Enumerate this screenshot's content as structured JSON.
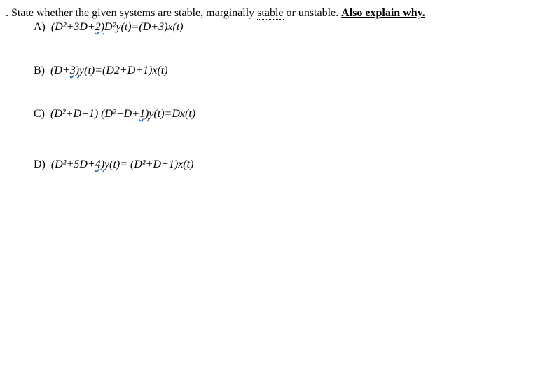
{
  "intro_part1": ". State whether the given systems are stable, marginally ",
  "intro_stable": "stable",
  "intro_part2": " or unstable.  ",
  "intro_explain": "Also explain why.",
  "A": {
    "label": "A)",
    "p1": "(D²+3D+",
    "num": "2)",
    "p2": "D²y(t)=(D+3)x(t)"
  },
  "B": {
    "label": "B)",
    "p1": "(D+",
    "num": "3)",
    "p2": "y(t)=(D2+D+1)x(t)"
  },
  "C": {
    "label": "C)",
    "p1": "(D²+D+1) (D²+D+",
    "num": "1)",
    "p2": "y(t)=Dx(t)"
  },
  "D": {
    "label": "D)",
    "p1": "(D²+5D+",
    "num": "4)",
    "p2": "y(t)= (D²+D+1)x(t)"
  }
}
